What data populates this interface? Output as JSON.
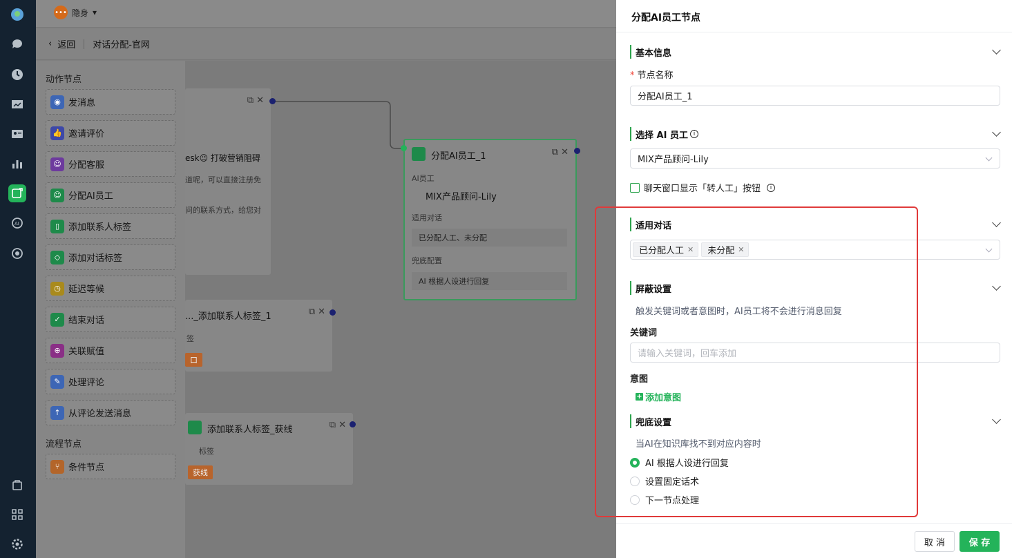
{
  "topbar": {
    "status": "隐身"
  },
  "crumb": {
    "back": "返回",
    "title": "对话分配-官网"
  },
  "palette": {
    "action_title": "动作节点",
    "items": [
      "发消息",
      "邀请评价",
      "分配客服",
      "分配AI员工",
      "添加联系人标签",
      "添加对话标签",
      "延迟等候",
      "结束对话",
      "关联赋值",
      "处理评论",
      "从评论发送消息"
    ],
    "flow_title": "流程节点",
    "flow_items": [
      "条件节点"
    ]
  },
  "canvas": {
    "card1": {
      "line1": "esk😉 打破营销阻碍",
      "line2": "道呢，可以直接注册免",
      "line3": "问的联系方式，给您对"
    },
    "card_ai": {
      "title": "分配AI员工_1",
      "label_staff": "AI员工",
      "staff": "MIX产品顾问-Lily",
      "label_dialog": "适用对话",
      "dialog": "已分配人工、未分配",
      "label_fallback": "兜底配置",
      "fallback": "AI 根据人设进行回复"
    },
    "card_tag1": {
      "title": "..._添加联系人标签_1",
      "sub": "签",
      "tag": "口"
    },
    "card_tag2": {
      "title": "添加联系人标签_获线",
      "sub": "标签",
      "tag": "获线"
    }
  },
  "drawer": {
    "title": "分配AI员工节点",
    "basic": {
      "title": "基本信息",
      "name_label": "节点名称",
      "name_value": "分配AI员工_1"
    },
    "select_ai": {
      "title": "选择 AI 员工",
      "value": "MIX产品顾问-Lily",
      "checkbox": "聊天窗口显示「转人工」按钮"
    },
    "dialog": {
      "title": "适用对话",
      "chips": [
        "已分配人工",
        "未分配"
      ]
    },
    "shield": {
      "title": "屏蔽设置",
      "hint": "触发关键词或者意图时，AI员工将不会进行消息回复",
      "keyword_label": "关键词",
      "keyword_placeholder": "请输入关键词，回车添加",
      "intent_label": "意图",
      "add_intent": "添加意图"
    },
    "fallback": {
      "title": "兜底设置",
      "hint": "当AI在知识库找不到对应内容时",
      "options": [
        "AI 根据人设进行回复",
        "设置固定话术",
        "下一节点处理"
      ]
    },
    "footer": {
      "cancel": "取 消",
      "save": "保 存"
    }
  },
  "colors": {
    "accent": "#24b35a",
    "highlight": "#e03a3a",
    "rail": "#142230"
  }
}
